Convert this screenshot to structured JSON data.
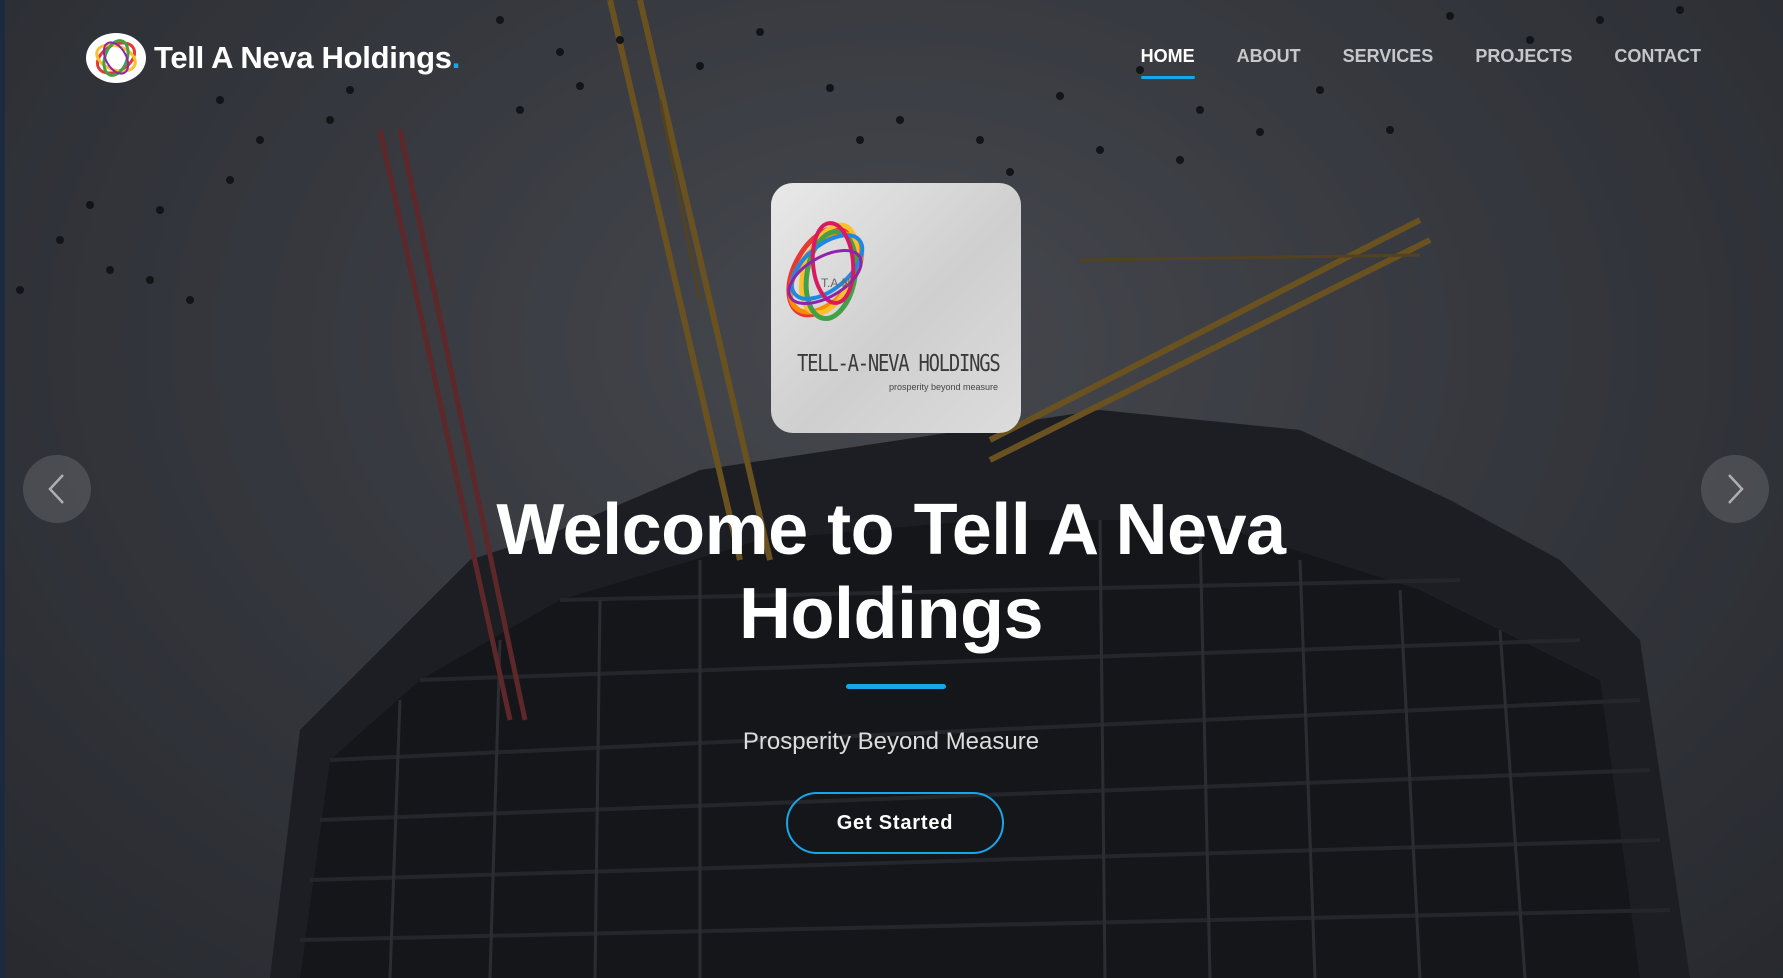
{
  "header": {
    "brand_name": "Tell A Neva Holdings",
    "brand_dot": ".",
    "logo_icon": "tan-logo-icon"
  },
  "nav": {
    "items": [
      {
        "label": "HOME",
        "active": true
      },
      {
        "label": "ABOUT",
        "active": false
      },
      {
        "label": "SERVICES",
        "active": false
      },
      {
        "label": "PROJECTS",
        "active": false
      },
      {
        "label": "CONTACT",
        "active": false
      }
    ]
  },
  "hero": {
    "logo_card_text": "TELL-A-NEVA HOLDINGS",
    "logo_card_tagline": "prosperity beyond measure",
    "logo_card_initials": "T.A.N",
    "title": "Welcome to Tell A Neva Holdings",
    "subtitle": "Prosperity Beyond Measure",
    "cta_label": "Get Started",
    "prev_icon": "chevron-left-icon",
    "next_icon": "chevron-right-icon"
  },
  "colors": {
    "accent": "#18a6e8",
    "text": "#ffffff",
    "background": "#3b3f46"
  }
}
